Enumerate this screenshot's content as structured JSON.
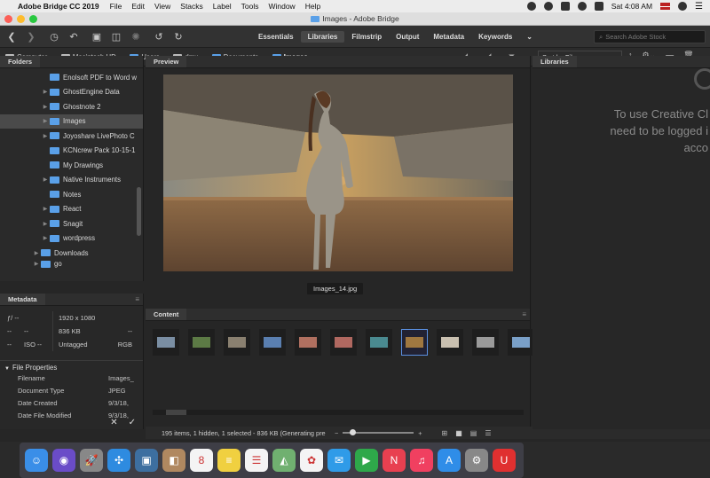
{
  "menubar": {
    "app_name": "Adobe Bridge CC 2019",
    "items": [
      "File",
      "Edit",
      "View",
      "Stacks",
      "Label",
      "Tools",
      "Window",
      "Help"
    ],
    "clock": "Sat 4:08 AM"
  },
  "window": {
    "title": "Images - Adobe Bridge"
  },
  "toolbar": {
    "workspaces": [
      "Essentials",
      "Libraries",
      "Filmstrip",
      "Output",
      "Metadata",
      "Keywords"
    ],
    "active_workspace": "Libraries",
    "search_placeholder": "Search Adobe Stock"
  },
  "path": {
    "crumbs": [
      "Computer",
      "Macintosh HD",
      "Users",
      "dmx",
      "Documents",
      "Images"
    ],
    "sort_label": "Sort by Filename"
  },
  "folders": {
    "title": "Folders",
    "items": [
      {
        "label": "Enolsoft PDF to Word w"
      },
      {
        "label": "GhostEngine Data"
      },
      {
        "label": "Ghostnote 2"
      },
      {
        "label": "Images"
      },
      {
        "label": "Joyoshare LivePhoto C"
      },
      {
        "label": "KCNcrew Pack 10-15-1"
      },
      {
        "label": "My Drawings"
      },
      {
        "label": "Native Instruments"
      },
      {
        "label": "Notes"
      },
      {
        "label": "React"
      },
      {
        "label": "Snagit"
      },
      {
        "label": "wordpress"
      },
      {
        "label": "Downloads"
      },
      {
        "label": "go"
      }
    ]
  },
  "preview": {
    "title": "Preview",
    "filename": "Images_14.jpg"
  },
  "content": {
    "title": "Content",
    "thumb_colors": [
      "#7a8ea3",
      "#5c7a45",
      "#8a8070",
      "#5a7fb0",
      "#b07060",
      "#b06860",
      "#4a8a90",
      "#a07840",
      "#c9c0b0",
      "#9a9a9a",
      "#7aa0c8"
    ]
  },
  "metadata": {
    "title": "Metadata",
    "camera": [
      "ƒ/ --",
      "--",
      "--",
      "--",
      "ISO --"
    ],
    "dims": "1920 x 1080",
    "size": "836 KB",
    "ppi": "--",
    "profile": "Untagged",
    "mode": "RGB",
    "section": "File Properties",
    "rows": [
      {
        "k": "Filename",
        "v": "Images_"
      },
      {
        "k": "Document Type",
        "v": "JPEG"
      },
      {
        "k": "Date Created",
        "v": "9/3/18,"
      },
      {
        "k": "Date File Modified",
        "v": "9/3/18,"
      }
    ]
  },
  "status": {
    "text": "195 items, 1 hidden, 1 selected - 836 KB (Generating pre"
  },
  "libraries": {
    "title": "Libraries",
    "message_lines": [
      "To use Creative Cl",
      "need to be logged i",
      "acco"
    ]
  },
  "dock": {
    "apps": [
      {
        "name": "finder-icon",
        "color": "#3a8ee8",
        "glyph": "☺"
      },
      {
        "name": "siri-icon",
        "color": "#6a4cc8",
        "glyph": "◉"
      },
      {
        "name": "launchpad-icon",
        "color": "#888888",
        "glyph": "🚀"
      },
      {
        "name": "safari-icon",
        "color": "#2e8be0",
        "glyph": "✣"
      },
      {
        "name": "photo-browser-icon",
        "color": "#3d6fa0",
        "glyph": "▣"
      },
      {
        "name": "contacts-icon",
        "color": "#b08860",
        "glyph": "◧"
      },
      {
        "name": "calendar-icon",
        "color": "#f4f4f4",
        "glyph": "8"
      },
      {
        "name": "notes-icon",
        "color": "#f0d040",
        "glyph": "≡"
      },
      {
        "name": "reminders-icon",
        "color": "#f4f4f4",
        "glyph": "☰"
      },
      {
        "name": "maps-icon",
        "color": "#70b070",
        "glyph": "◭"
      },
      {
        "name": "photos-icon",
        "color": "#f4f4f4",
        "glyph": "✿"
      },
      {
        "name": "messages-icon",
        "color": "#2f9be8",
        "glyph": "✉"
      },
      {
        "name": "facetime-icon",
        "color": "#2ea84a",
        "glyph": "▶"
      },
      {
        "name": "news-icon",
        "color": "#e84050",
        "glyph": "N"
      },
      {
        "name": "music-icon",
        "color": "#f04060",
        "glyph": "♫"
      },
      {
        "name": "app-store-icon",
        "color": "#2f8de8",
        "glyph": "A"
      },
      {
        "name": "system-preferences-icon",
        "color": "#888888",
        "glyph": "⚙"
      },
      {
        "name": "magnet-icon",
        "color": "#e03030",
        "glyph": "U"
      }
    ]
  }
}
